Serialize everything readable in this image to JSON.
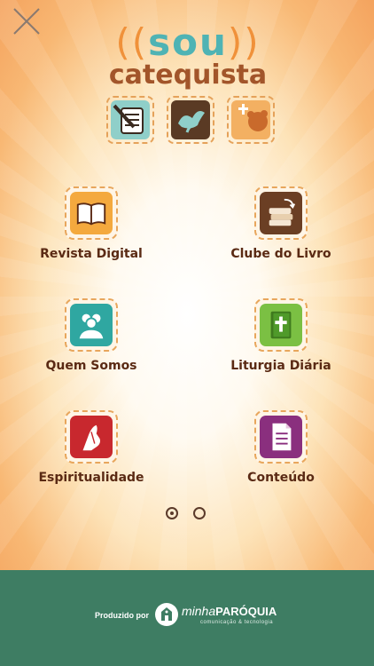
{
  "logo": {
    "line1": "sou",
    "line2": "catequista"
  },
  "menu": [
    {
      "label": "Revista Digital",
      "icon": "book-icon"
    },
    {
      "label": "Clube do Livro",
      "icon": "stacked-books-icon"
    },
    {
      "label": "Quem Somos",
      "icon": "people-icon"
    },
    {
      "label": "Liturgia Diária",
      "icon": "bible-cross-icon"
    },
    {
      "label": "Espiritualidade",
      "icon": "praying-hands-icon"
    },
    {
      "label": "Conteúdo",
      "icon": "document-icon"
    }
  ],
  "pager": {
    "pages": 2,
    "active": 1
  },
  "footer": {
    "produced_by": "Produzido por",
    "brand_minha": "minha",
    "brand_paroquia": "PARÓQUIA",
    "brand_sub": "comunicação & tecnologia"
  },
  "colors": {
    "footer_bg": "#3e7d63",
    "label_text": "#5a2a14",
    "tile_border": "#e8a65c"
  }
}
